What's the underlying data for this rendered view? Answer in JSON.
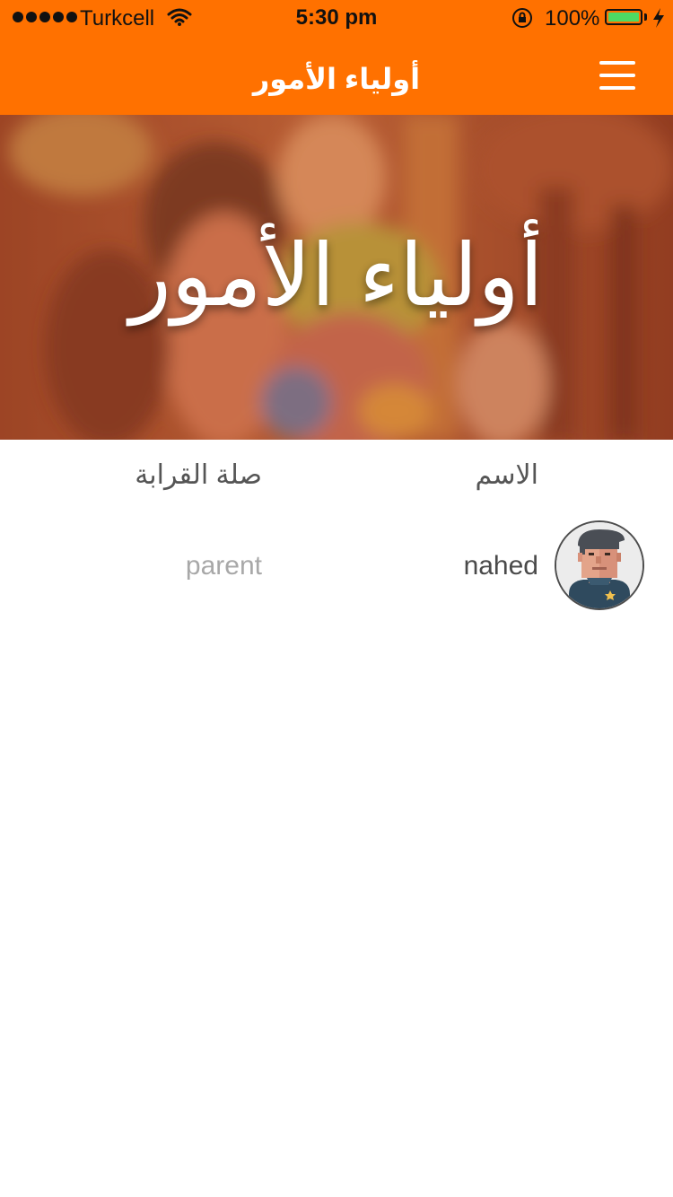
{
  "status_bar": {
    "carrier": "Turkcell",
    "time": "5:30 pm",
    "battery": "100%"
  },
  "nav": {
    "title": "أولياء الأمور",
    "menu_icon": "hamburger-menu-icon"
  },
  "hero": {
    "title": "أولياء الأمور"
  },
  "table": {
    "headers": {
      "name": "الاسم",
      "relation": "صلة القرابة"
    },
    "rows": [
      {
        "name": "nahed",
        "relation": "parent",
        "avatar": "user-avatar-icon"
      }
    ]
  },
  "colors": {
    "accent": "#ff7100",
    "hero_tint": "#c0592c"
  }
}
